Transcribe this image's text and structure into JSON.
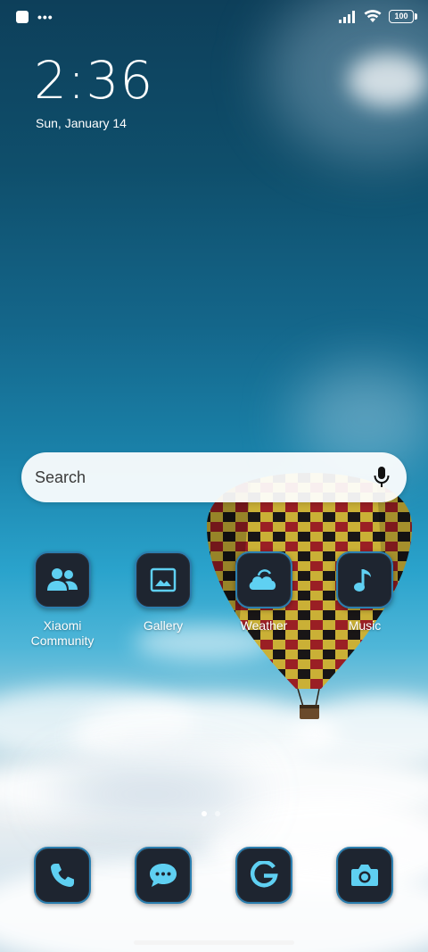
{
  "status_bar": {
    "battery": "100",
    "icons": [
      "notification-square-icon",
      "more-dots-icon",
      "signal-icon",
      "wifi-icon",
      "battery-icon"
    ]
  },
  "clock": {
    "time": "2:36",
    "date": "Sun, January 14"
  },
  "search": {
    "placeholder": "Search",
    "icon": "mic-icon"
  },
  "apps": [
    {
      "label": "Xiaomi\nCommunity",
      "icon": "people-icon"
    },
    {
      "label": "Gallery",
      "icon": "image-icon"
    },
    {
      "label": "Weather",
      "icon": "cloud-icon"
    },
    {
      "label": "Music",
      "icon": "music-note-icon"
    }
  ],
  "dock": [
    {
      "name": "Phone",
      "icon": "phone-icon"
    },
    {
      "name": "Messages",
      "icon": "chat-bubble-icon"
    },
    {
      "name": "Google",
      "icon": "google-g-icon"
    },
    {
      "name": "Camera",
      "icon": "camera-icon"
    }
  ],
  "pages": {
    "count": 2,
    "active": 1
  },
  "colors": {
    "icon_accent": "#5fd0f2",
    "tile_bg": "#1e2530",
    "tile_border": "#2b7fb0"
  }
}
